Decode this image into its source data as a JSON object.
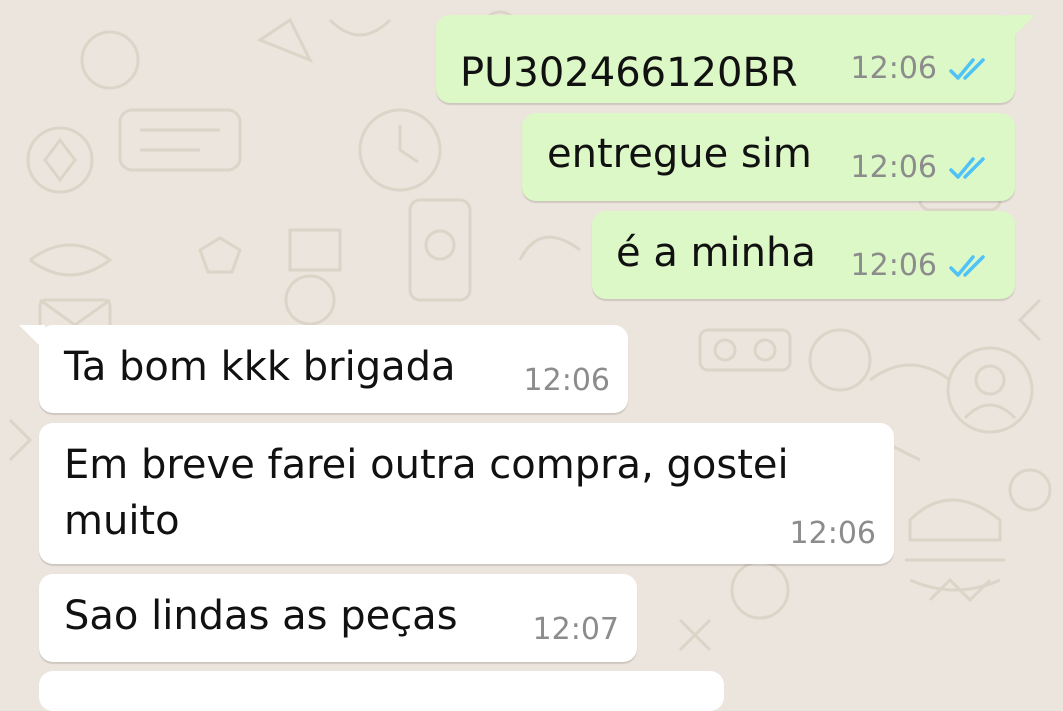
{
  "chat": {
    "messages": [
      {
        "direction": "outgoing",
        "text": "PU302466120BR",
        "time": "12:06",
        "status": "read"
      },
      {
        "direction": "outgoing",
        "text": "entregue sim",
        "time": "12:06",
        "status": "read"
      },
      {
        "direction": "outgoing",
        "text": "é a minha",
        "time": "12:06",
        "status": "read"
      },
      {
        "direction": "incoming",
        "text": "Ta bom kkk brigada",
        "time": "12:06"
      },
      {
        "direction": "incoming",
        "text_line1": "Em breve farei outra compra, gostei",
        "text_line2": "muito",
        "time": "12:06"
      },
      {
        "direction": "incoming",
        "text": "Sao lindas as peças",
        "time": "12:07"
      }
    ]
  },
  "colors": {
    "wallpaper": "#ECE5DD",
    "outgoing_bubble": "#DCF8C6",
    "incoming_bubble": "#FFFFFF",
    "timestamp": "#8C8C8C",
    "read_tick": "#4FC3F7"
  },
  "icons": {
    "read_receipt": "double-check-icon"
  }
}
